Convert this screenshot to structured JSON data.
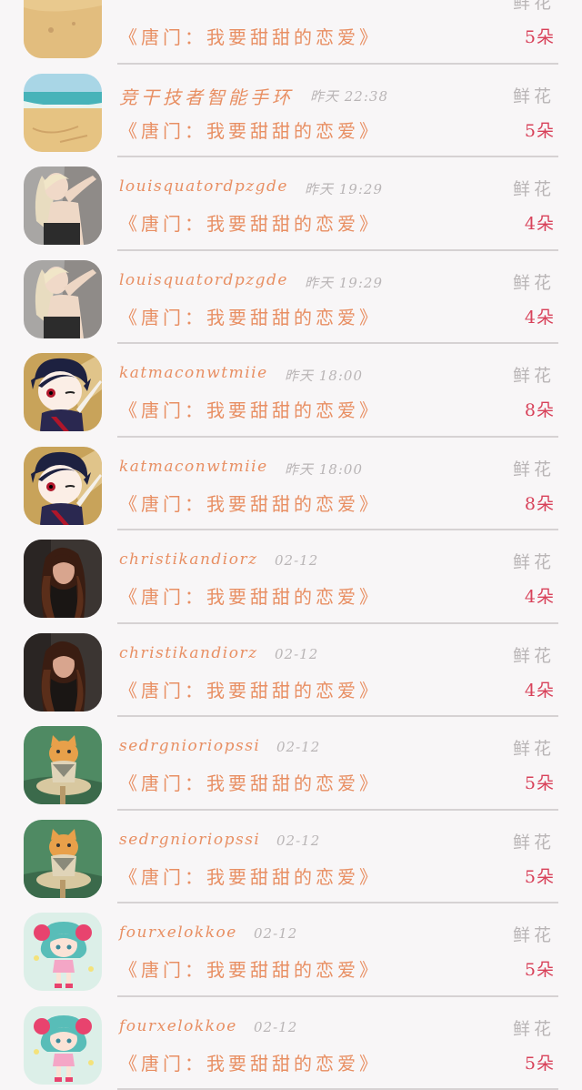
{
  "gift_label": "鲜花",
  "items": [
    {
      "name": "",
      "time": "",
      "drama": "《唐门：我要甜甜的恋爱》",
      "count": "5朵",
      "avatar": "beach-sand"
    },
    {
      "name": "竞干技者智能手环",
      "time": "昨天 22:38",
      "drama": "《唐门：我要甜甜的恋爱》",
      "count": "5朵",
      "avatar": "beach"
    },
    {
      "name": "louisquatordpzgde",
      "time": "昨天 19:29",
      "drama": "《唐门：我要甜甜的恋爱》",
      "count": "4朵",
      "avatar": "blonde-woman"
    },
    {
      "name": "louisquatordpzgde",
      "time": "昨天 19:29",
      "drama": "《唐门：我要甜甜的恋爱》",
      "count": "4朵",
      "avatar": "blonde-woman"
    },
    {
      "name": "katmaconwtmiie",
      "time": "昨天 18:00",
      "drama": "《唐门：我要甜甜的恋爱》",
      "count": "8朵",
      "avatar": "anime-ninja"
    },
    {
      "name": "katmaconwtmiie",
      "time": "昨天 18:00",
      "drama": "《唐门：我要甜甜的恋爱》",
      "count": "8朵",
      "avatar": "anime-ninja"
    },
    {
      "name": "christikandiorz",
      "time": "02-12",
      "drama": "《唐门：我要甜甜的恋爱》",
      "count": "4朵",
      "avatar": "brunette-woman"
    },
    {
      "name": "christikandiorz",
      "time": "02-12",
      "drama": "《唐门：我要甜甜的恋爱》",
      "count": "4朵",
      "avatar": "brunette-woman"
    },
    {
      "name": "sedrgnioriopssi",
      "time": "02-12",
      "drama": "《唐门：我要甜甜的恋爱》",
      "count": "5朵",
      "avatar": "cat-painting"
    },
    {
      "name": "sedrgnioriopssi",
      "time": "02-12",
      "drama": "《唐门：我要甜甜的恋爱》",
      "count": "5朵",
      "avatar": "cat-painting"
    },
    {
      "name": "fourxelokkoe",
      "time": "02-12",
      "drama": "《唐门：我要甜甜的恋爱》",
      "count": "5朵",
      "avatar": "chibi-girl"
    },
    {
      "name": "fourxelokkoe",
      "time": "02-12",
      "drama": "《唐门：我要甜甜的恋爱》",
      "count": "5朵",
      "avatar": "chibi-girl"
    }
  ]
}
